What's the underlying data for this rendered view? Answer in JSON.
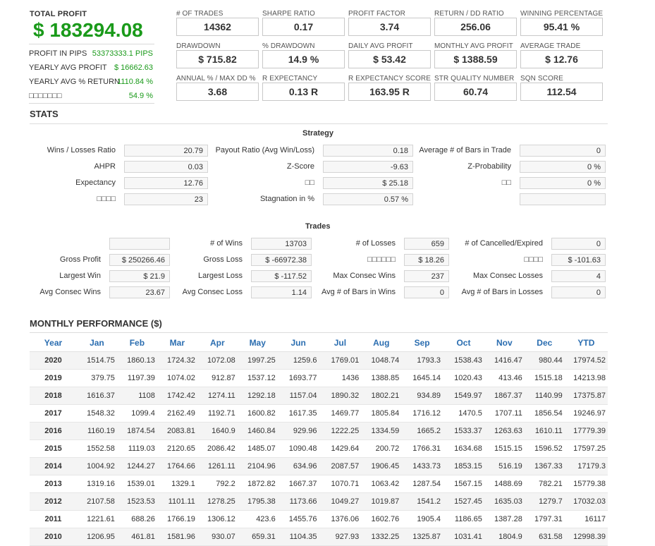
{
  "summary": {
    "total_profit_label": "TOTAL PROFIT",
    "total_profit_value": "$ 183294.08",
    "rows": [
      {
        "label": "PROFIT IN PIPS",
        "value": "53373333.1 PIPS"
      },
      {
        "label": "YEARLY AVG PROFIT",
        "value": "$ 16662.63"
      },
      {
        "label": "YEARLY AVG % RETURN",
        "value": "1110.84 %"
      },
      {
        "label": "□□□□□□□",
        "value": "54.9 %"
      }
    ]
  },
  "metrics": [
    {
      "label": "# OF TRADES",
      "value": "14362"
    },
    {
      "label": "SHARPE RATIO",
      "value": "0.17"
    },
    {
      "label": "PROFIT FACTOR",
      "value": "3.74"
    },
    {
      "label": "RETURN / DD RATIO",
      "value": "256.06"
    },
    {
      "label": "WINNING PERCENTAGE",
      "value": "95.41 %"
    },
    {
      "label": "DRAWDOWN",
      "value": "$ 715.82"
    },
    {
      "label": "% DRAWDOWN",
      "value": "14.9 %"
    },
    {
      "label": "DAILY AVG PROFIT",
      "value": "$ 53.42"
    },
    {
      "label": "MONTHLY AVG PROFIT",
      "value": "$ 1388.59"
    },
    {
      "label": "AVERAGE TRADE",
      "value": "$ 12.76"
    },
    {
      "label": "ANNUAL % / MAX DD %",
      "value": "3.68"
    },
    {
      "label": "R EXPECTANCY",
      "value": "0.13 R"
    },
    {
      "label": "R EXPECTANCY SCORE",
      "value": "163.95 R"
    },
    {
      "label": "STR QUALITY NUMBER",
      "value": "60.74"
    },
    {
      "label": "SQN SCORE",
      "value": "112.54"
    }
  ],
  "stats_title": "STATS",
  "strategy": {
    "title": "Strategy",
    "rows": [
      [
        {
          "label": "Wins / Losses Ratio",
          "value": "20.79"
        },
        {
          "label": "Payout Ratio (Avg Win/Loss)",
          "value": "0.18"
        },
        {
          "label": "Average # of Bars in Trade",
          "value": "0"
        }
      ],
      [
        {
          "label": "AHPR",
          "value": "0.03"
        },
        {
          "label": "Z-Score",
          "value": "-9.63"
        },
        {
          "label": "Z-Probability",
          "value": "0 %"
        }
      ],
      [
        {
          "label": "Expectancy",
          "value": "12.76"
        },
        {
          "label": "□□",
          "value": "$ 25.18"
        },
        {
          "label": "□□",
          "value": "0 %"
        }
      ],
      [
        {
          "label": "□□□□",
          "value": "23"
        },
        {
          "label": "Stagnation in %",
          "value": "0.57 %"
        },
        {
          "label": "",
          "value": ""
        }
      ]
    ]
  },
  "trades": {
    "title": "Trades",
    "rows": [
      [
        {
          "label": "",
          "value": ""
        },
        {
          "label": "# of Wins",
          "value": "13703"
        },
        {
          "label": "# of Losses",
          "value": "659"
        },
        {
          "label": "# of Cancelled/Expired",
          "value": "0"
        }
      ],
      [
        {
          "label": "Gross Profit",
          "value": "$ 250266.46"
        },
        {
          "label": "Gross Loss",
          "value": "$ -66972.38"
        },
        {
          "label": "□□□□□□",
          "value": "$ 18.26"
        },
        {
          "label": "□□□□",
          "value": "$ -101.63"
        }
      ],
      [
        {
          "label": "Largest Win",
          "value": "$ 21.9"
        },
        {
          "label": "Largest Loss",
          "value": "$ -117.52"
        },
        {
          "label": "Max Consec Wins",
          "value": "237"
        },
        {
          "label": "Max Consec Losses",
          "value": "4"
        }
      ],
      [
        {
          "label": "Avg Consec Wins",
          "value": "23.67"
        },
        {
          "label": "Avg Consec Loss",
          "value": "1.14"
        },
        {
          "label": "Avg # of Bars in Wins",
          "value": "0"
        },
        {
          "label": "Avg # of Bars in Losses",
          "value": "0"
        }
      ]
    ]
  },
  "monthly": {
    "title": "MONTHLY PERFORMANCE ($)",
    "headers": [
      "Year",
      "Jan",
      "Feb",
      "Mar",
      "Apr",
      "May",
      "Jun",
      "Jul",
      "Aug",
      "Sep",
      "Oct",
      "Nov",
      "Dec",
      "YTD"
    ],
    "rows": [
      [
        "2020",
        "1514.75",
        "1860.13",
        "1724.32",
        "1072.08",
        "1997.25",
        "1259.6",
        "1769.01",
        "1048.74",
        "1793.3",
        "1538.43",
        "1416.47",
        "980.44",
        "17974.52"
      ],
      [
        "2019",
        "379.75",
        "1197.39",
        "1074.02",
        "912.87",
        "1537.12",
        "1693.77",
        "1436",
        "1388.85",
        "1645.14",
        "1020.43",
        "413.46",
        "1515.18",
        "14213.98"
      ],
      [
        "2018",
        "1616.37",
        "1108",
        "1742.42",
        "1274.11",
        "1292.18",
        "1157.04",
        "1890.32",
        "1802.21",
        "934.89",
        "1549.97",
        "1867.37",
        "1140.99",
        "17375.87"
      ],
      [
        "2017",
        "1548.32",
        "1099.4",
        "2162.49",
        "1192.71",
        "1600.82",
        "1617.35",
        "1469.77",
        "1805.84",
        "1716.12",
        "1470.5",
        "1707.11",
        "1856.54",
        "19246.97"
      ],
      [
        "2016",
        "1160.19",
        "1874.54",
        "2083.81",
        "1640.9",
        "1460.84",
        "929.96",
        "1222.25",
        "1334.59",
        "1665.2",
        "1533.37",
        "1263.63",
        "1610.11",
        "17779.39"
      ],
      [
        "2015",
        "1552.58",
        "1119.03",
        "2120.65",
        "2086.42",
        "1485.07",
        "1090.48",
        "1429.64",
        "200.72",
        "1766.31",
        "1634.68",
        "1515.15",
        "1596.52",
        "17597.25"
      ],
      [
        "2014",
        "1004.92",
        "1244.27",
        "1764.66",
        "1261.11",
        "2104.96",
        "634.96",
        "2087.57",
        "1906.45",
        "1433.73",
        "1853.15",
        "516.19",
        "1367.33",
        "17179.3"
      ],
      [
        "2013",
        "1319.16",
        "1539.01",
        "1329.1",
        "792.2",
        "1872.82",
        "1667.37",
        "1070.71",
        "1063.42",
        "1287.54",
        "1567.15",
        "1488.69",
        "782.21",
        "15779.38"
      ],
      [
        "2012",
        "2107.58",
        "1523.53",
        "1101.11",
        "1278.25",
        "1795.38",
        "1173.66",
        "1049.27",
        "1019.87",
        "1541.2",
        "1527.45",
        "1635.03",
        "1279.7",
        "17032.03"
      ],
      [
        "2011",
        "1221.61",
        "688.26",
        "1766.19",
        "1306.12",
        "423.6",
        "1455.76",
        "1376.06",
        "1602.76",
        "1905.4",
        "1186.65",
        "1387.28",
        "1797.31",
        "16117"
      ],
      [
        "2010",
        "1206.95",
        "461.81",
        "1581.96",
        "930.07",
        "659.31",
        "1104.35",
        "927.93",
        "1332.25",
        "1325.87",
        "1031.41",
        "1804.9",
        "631.58",
        "12998.39"
      ]
    ]
  }
}
